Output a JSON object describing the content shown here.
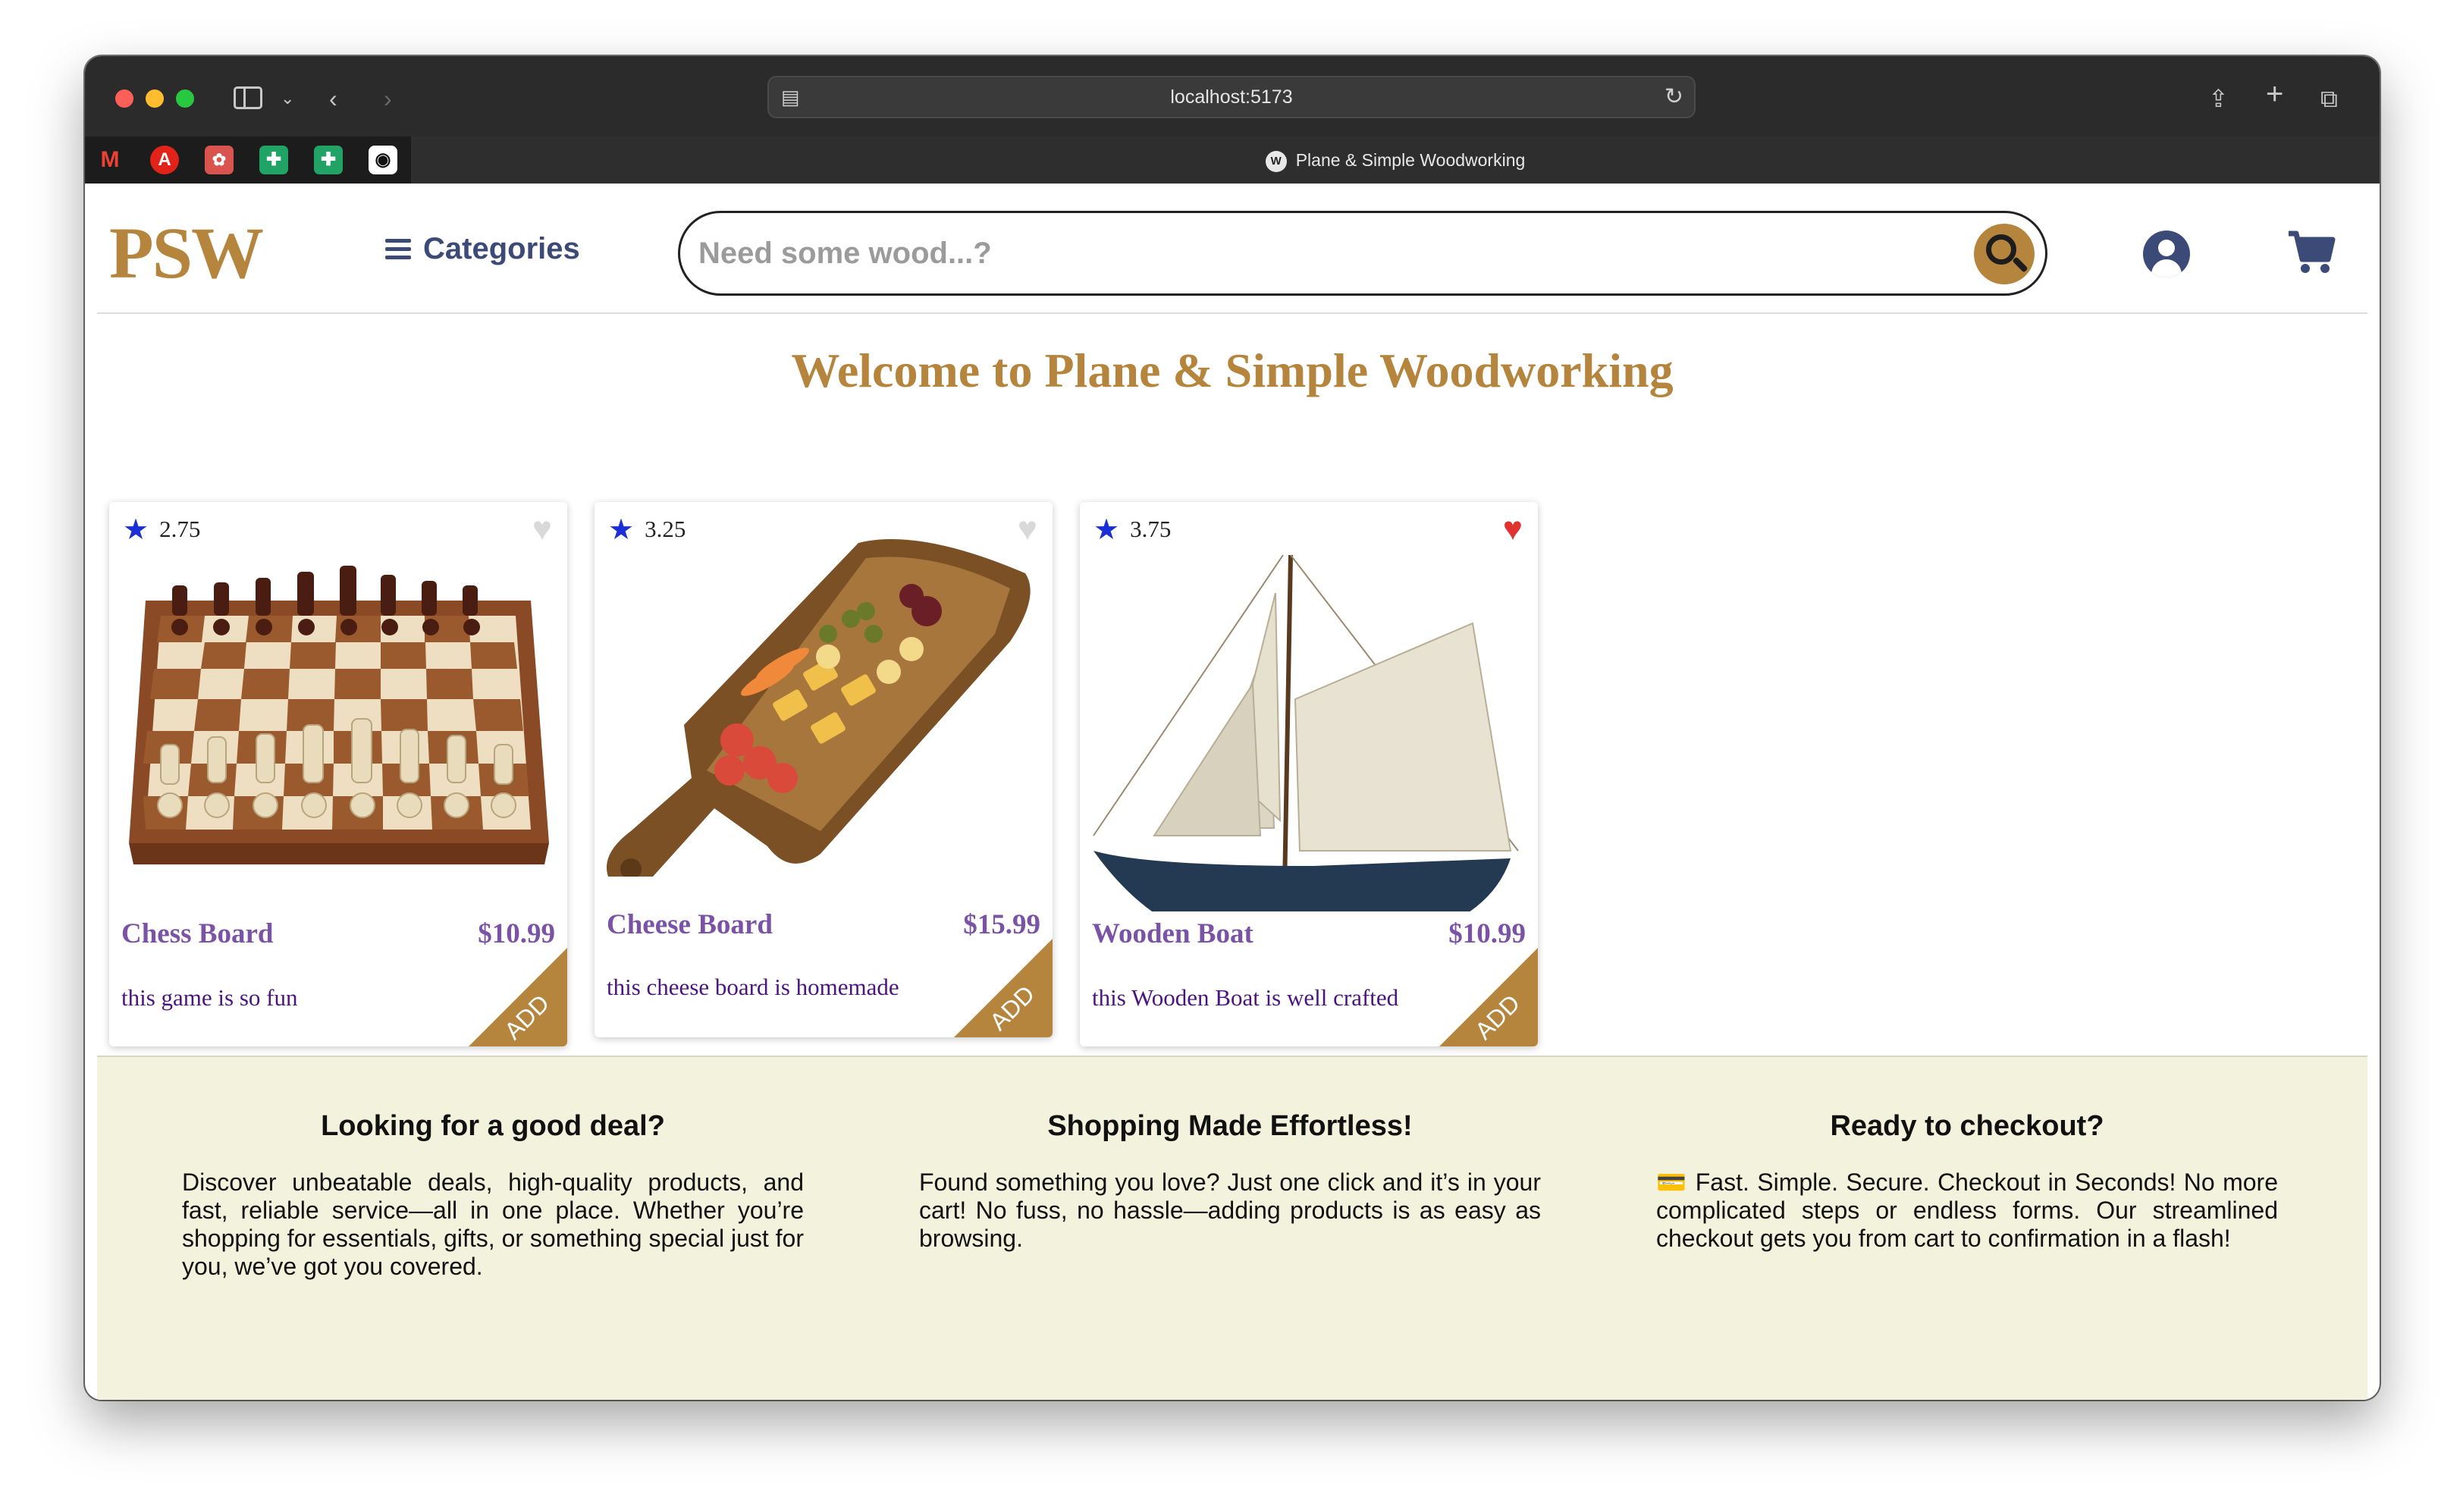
{
  "browser": {
    "url": "localhost:5173",
    "tab_title": "Plane & Simple Woodworking",
    "bookmarks": [
      "gmail-icon",
      "angular-icon",
      "app-icon",
      "sheets-icon",
      "sheets-icon",
      "github-icon"
    ]
  },
  "header": {
    "logo": "PSW",
    "categories_label": "Categories",
    "search_placeholder": "Need some wood...?"
  },
  "main": {
    "welcome": "Welcome to Plane & Simple Woodworking",
    "products": [
      {
        "name": "Chess Board",
        "price": "$10.99",
        "rating": "2.75",
        "description": "this game is so fun",
        "favorited": false,
        "add_label": "ADD"
      },
      {
        "name": "Cheese Board",
        "price": "$15.99",
        "rating": "3.25",
        "description": "this cheese board is homemade",
        "favorited": false,
        "add_label": "ADD"
      },
      {
        "name": "Wooden Boat",
        "price": "$10.99",
        "rating": "3.75",
        "description": "this Wooden Boat is well crafted",
        "favorited": true,
        "add_label": "ADD"
      }
    ]
  },
  "footer": {
    "columns": [
      {
        "title": "Looking for a good deal?",
        "text": "Discover unbeatable deals, high-quality products, and fast, reliable service—all in one place. Whether you’re shopping for essentials, gifts, or something special just for you, we’ve got you covered."
      },
      {
        "title": "Shopping Made Effortless!",
        "text": "Found something you love? Just one click and it’s in your cart! No fuss, no hassle—adding products is as easy as browsing."
      },
      {
        "title": "Ready to checkout?",
        "text": "💳 Fast. Simple. Secure. Checkout in Seconds! No more complicated steps or endless forms. Our streamlined checkout gets you from cart to confirmation in a flash!"
      }
    ]
  },
  "colors": {
    "brand_gold": "#b5853e",
    "nav_blue": "#3b4a76",
    "product_purple": "#7b53a6",
    "footer_bg": "#f3f3dd"
  }
}
